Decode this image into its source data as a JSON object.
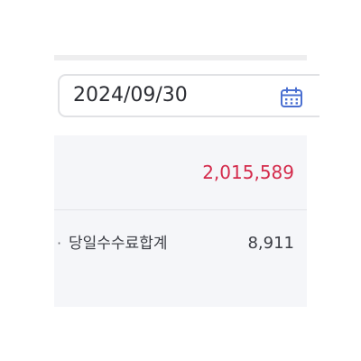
{
  "date_filter": {
    "value": "2024/09/30",
    "icon": "calendar-icon",
    "icon_color": "#4a6fd1"
  },
  "summary": {
    "total_amount": "2,015,589",
    "total_color": "#d42a4b",
    "fee_row": {
      "bullet": "·",
      "label": "당일수수료합계",
      "value": "8,911"
    }
  }
}
